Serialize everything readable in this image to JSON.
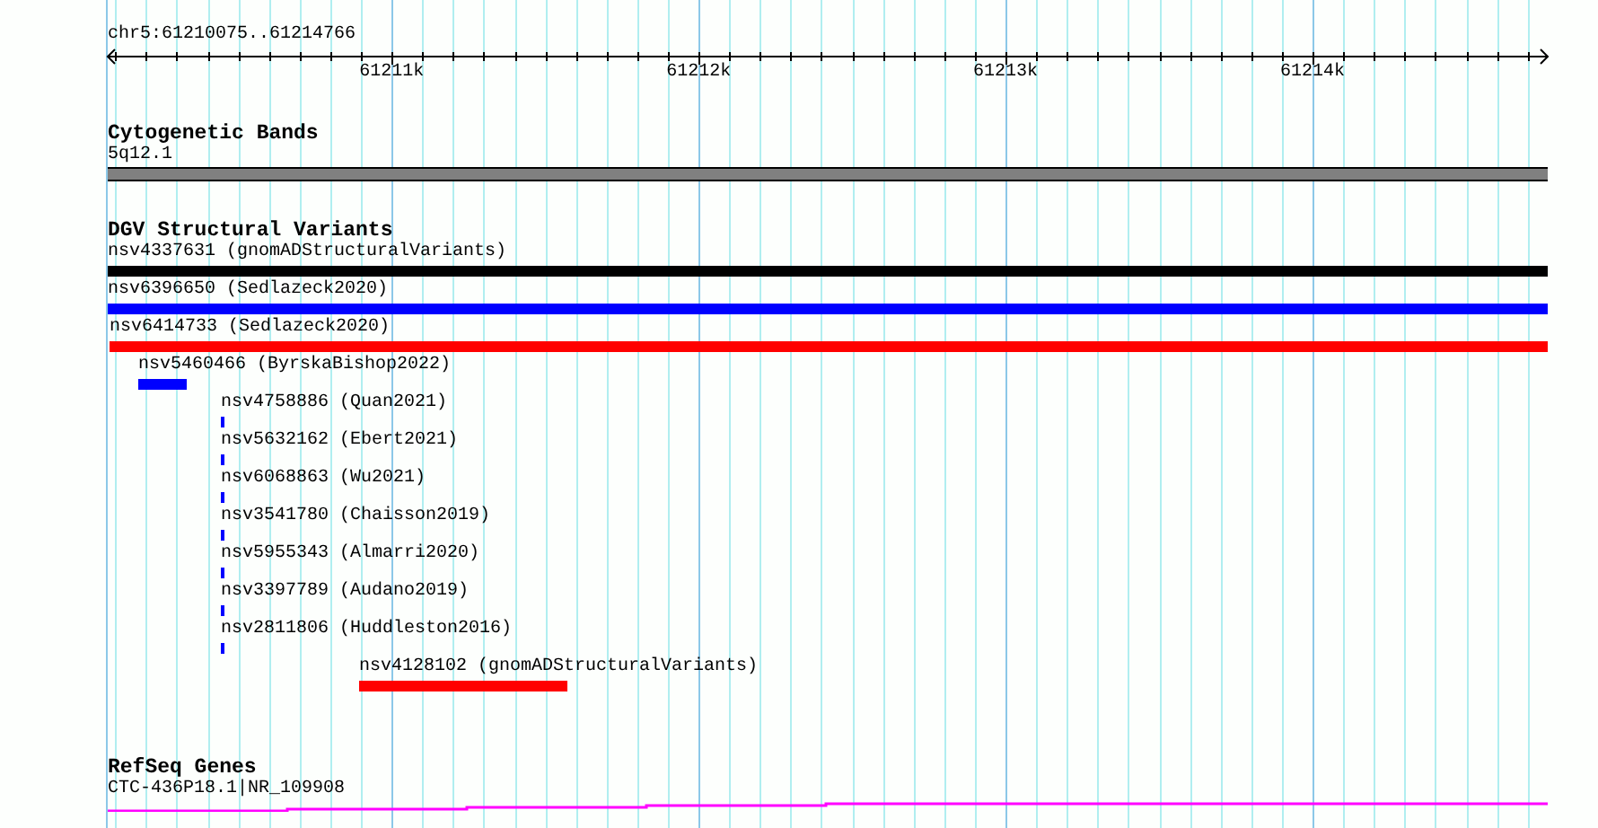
{
  "ruler": {
    "location": "chr5:61210075..61214766",
    "ticks": [
      {
        "label": "61211k"
      },
      {
        "label": "61212k"
      },
      {
        "label": "61213k"
      },
      {
        "label": "61214k"
      }
    ]
  },
  "tracks": [
    {
      "kind": "bands",
      "title": "Cytogenetic Bands",
      "features": [
        {
          "label": "5q12.1"
        }
      ]
    },
    {
      "kind": "variants",
      "title": "DGV Structural Variants",
      "features": [
        {
          "label": "nsv4337631 (gnomADStructuralVariants)",
          "color": "#000000"
        },
        {
          "label": "nsv6396650 (Sedlazeck2020)",
          "color": "#0000ff"
        },
        {
          "label": "nsv6414733 (Sedlazeck2020)",
          "color": "#ff0000"
        },
        {
          "label": "nsv5460466 (ByrskaBishop2022)",
          "color": "#0000ff"
        },
        {
          "label": "nsv4758886 (Quan2021)",
          "color": "#0000ff"
        },
        {
          "label": "nsv5632162 (Ebert2021)",
          "color": "#0000ff"
        },
        {
          "label": "nsv6068863 (Wu2021)",
          "color": "#0000ff"
        },
        {
          "label": "nsv3541780 (Chaisson2019)",
          "color": "#0000ff"
        },
        {
          "label": "nsv5955343 (Almarri2020)",
          "color": "#0000ff"
        },
        {
          "label": "nsv3397789 (Audano2019)",
          "color": "#0000ff"
        },
        {
          "label": "nsv2811806 (Huddleston2016)",
          "color": "#0000ff"
        },
        {
          "label": "nsv4128102 (gnomADStructuralVariants)",
          "color": "#ff0000"
        }
      ]
    },
    {
      "kind": "genes",
      "title": "RefSeq Genes",
      "features": [
        {
          "label": "CTC-436P18.1|NR_109908"
        }
      ]
    }
  ]
}
